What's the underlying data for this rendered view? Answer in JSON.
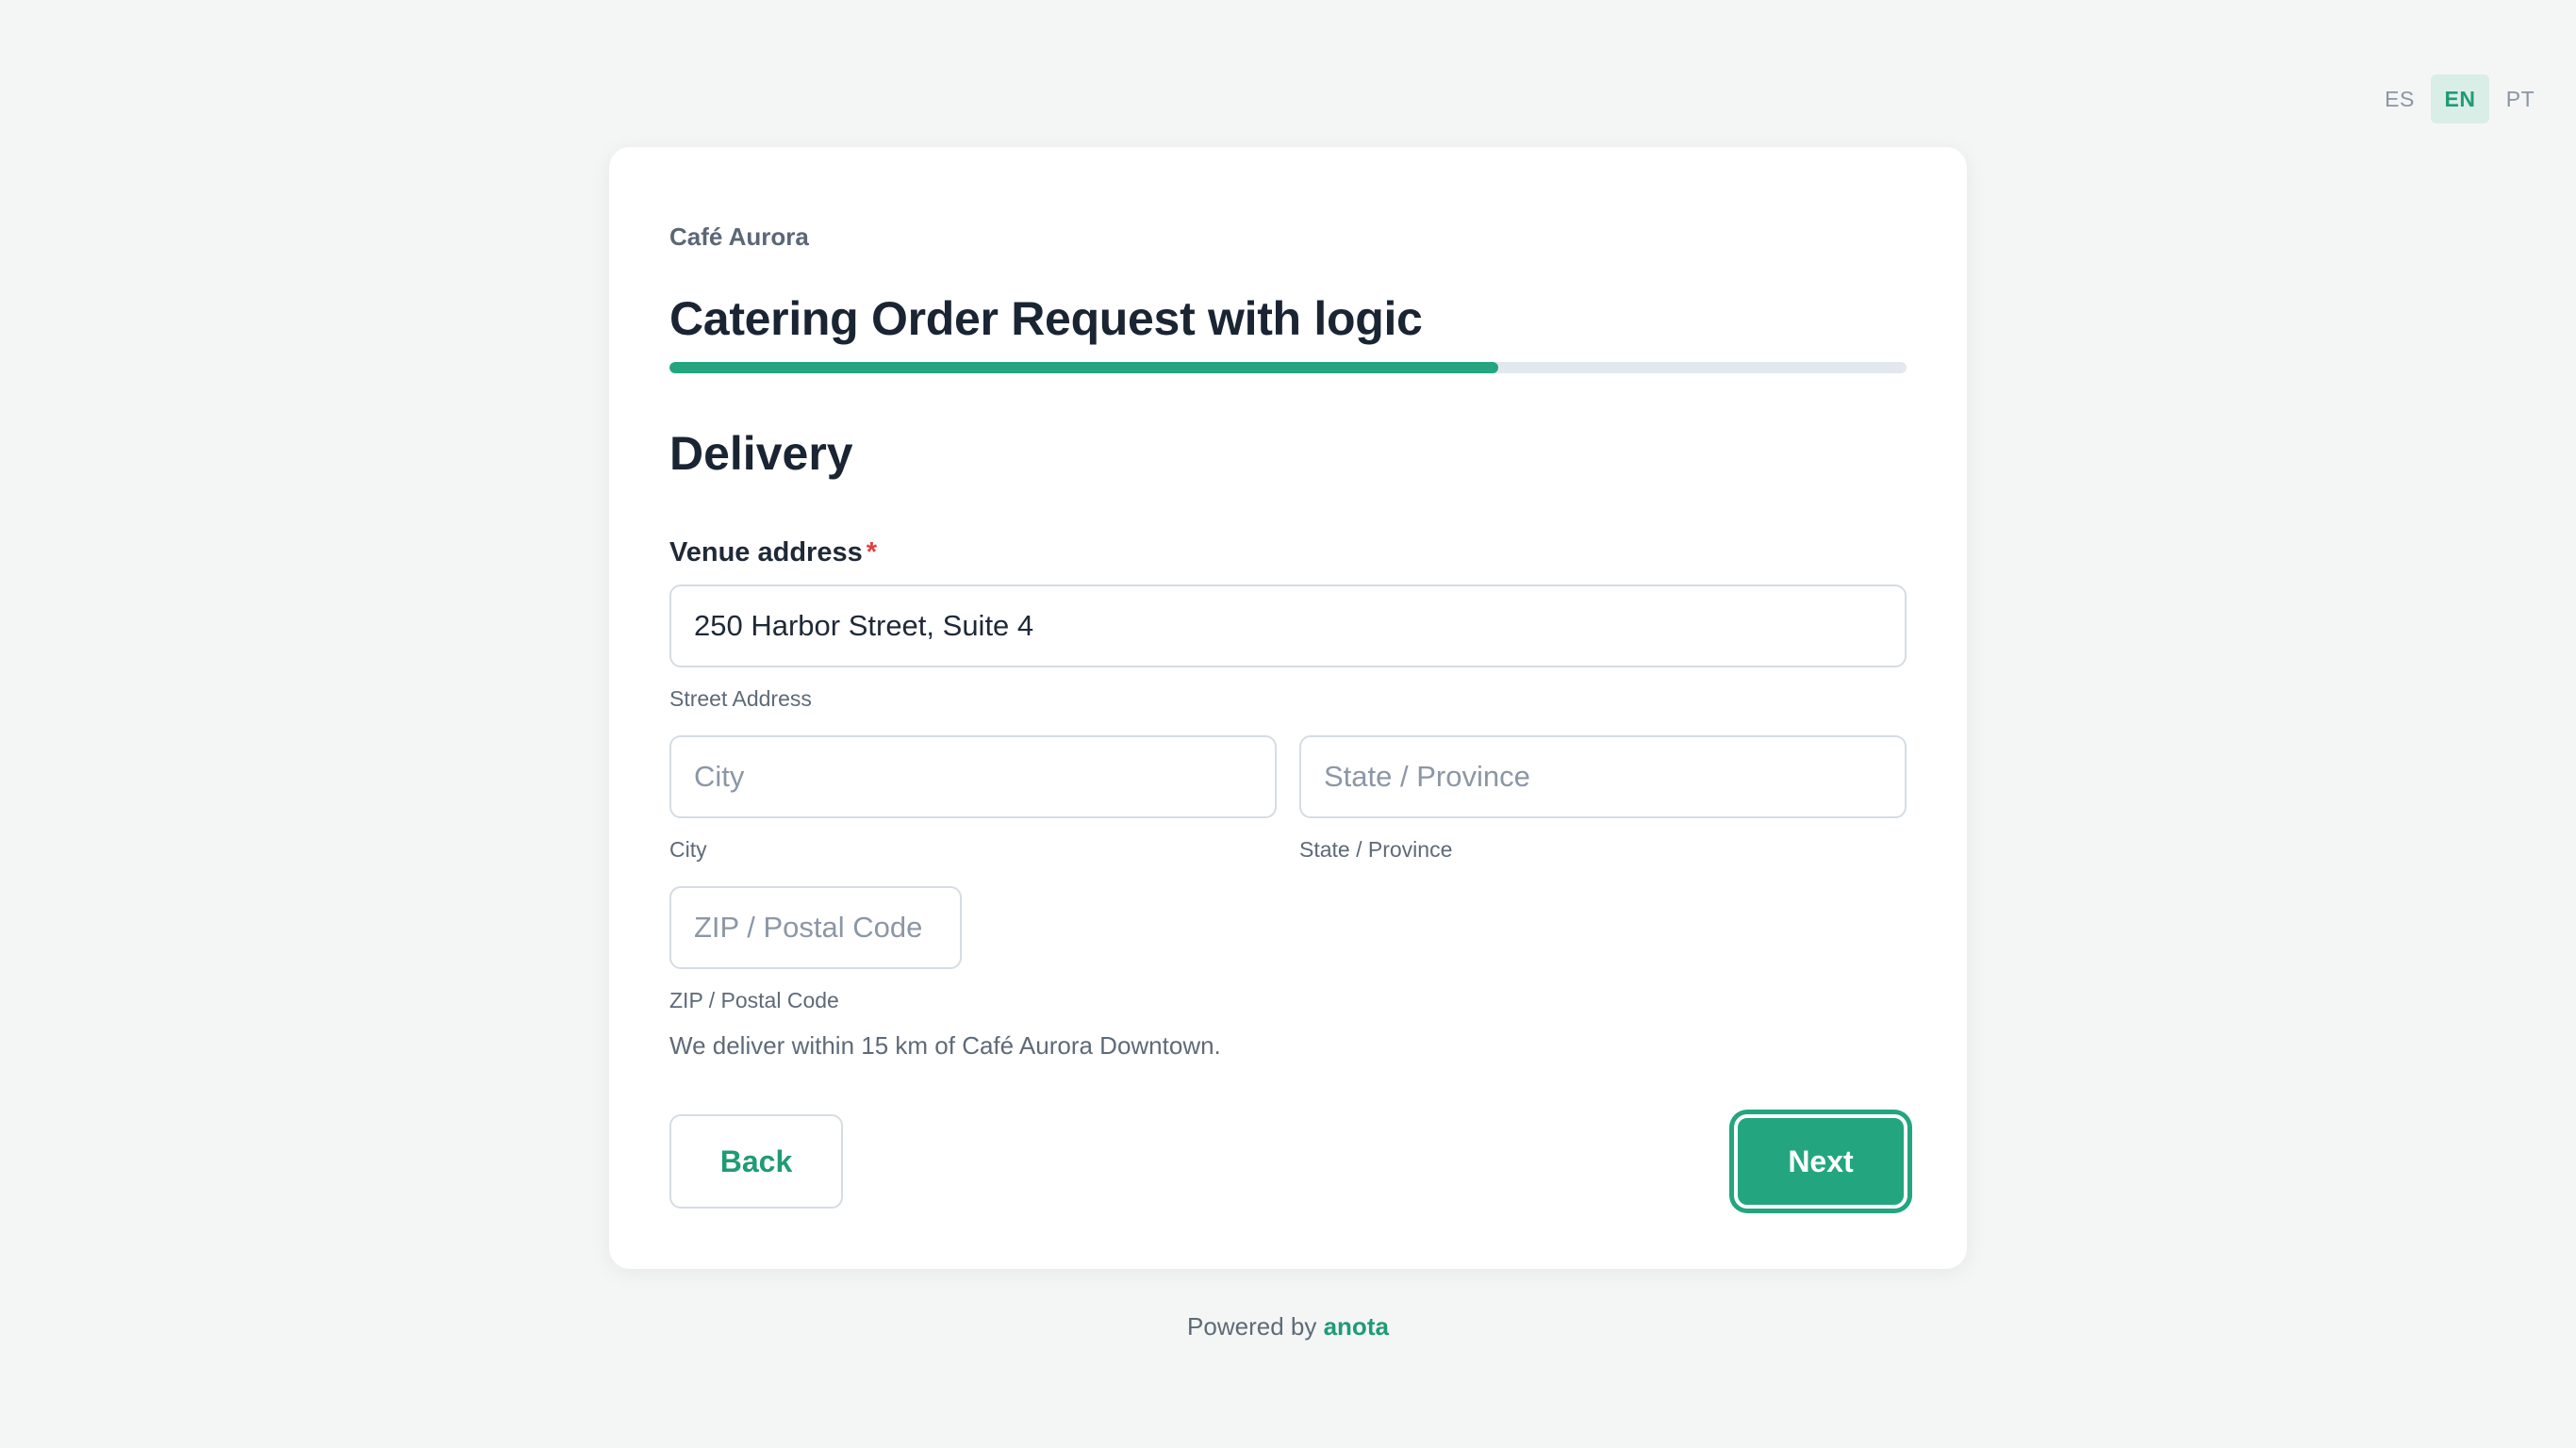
{
  "languages": {
    "es": "ES",
    "en": "EN",
    "pt": "PT",
    "active": "EN"
  },
  "form": {
    "brand": "Café Aurora",
    "title": "Catering Order Request with logic",
    "progress": 0.67,
    "section_title": "Delivery",
    "venue_label": "Venue address",
    "required_mark": "*",
    "street": {
      "value": "250 Harbor Street, Suite 4",
      "sublabel": "Street Address"
    },
    "city": {
      "placeholder": "City",
      "sublabel": "City"
    },
    "state": {
      "placeholder": "State / Province",
      "sublabel": "State / Province"
    },
    "zip": {
      "placeholder": "ZIP / Postal Code",
      "sublabel": "ZIP / Postal Code"
    },
    "help_text": "We deliver within 15 km of Café Aurora Downtown.",
    "back_label": "Back",
    "next_label": "Next"
  },
  "footer": {
    "prefix": "Powered by",
    "brand": "anota"
  },
  "colors": {
    "accent": "#23a67f",
    "background": "#f4f6f5",
    "required": "#e23d3d"
  }
}
